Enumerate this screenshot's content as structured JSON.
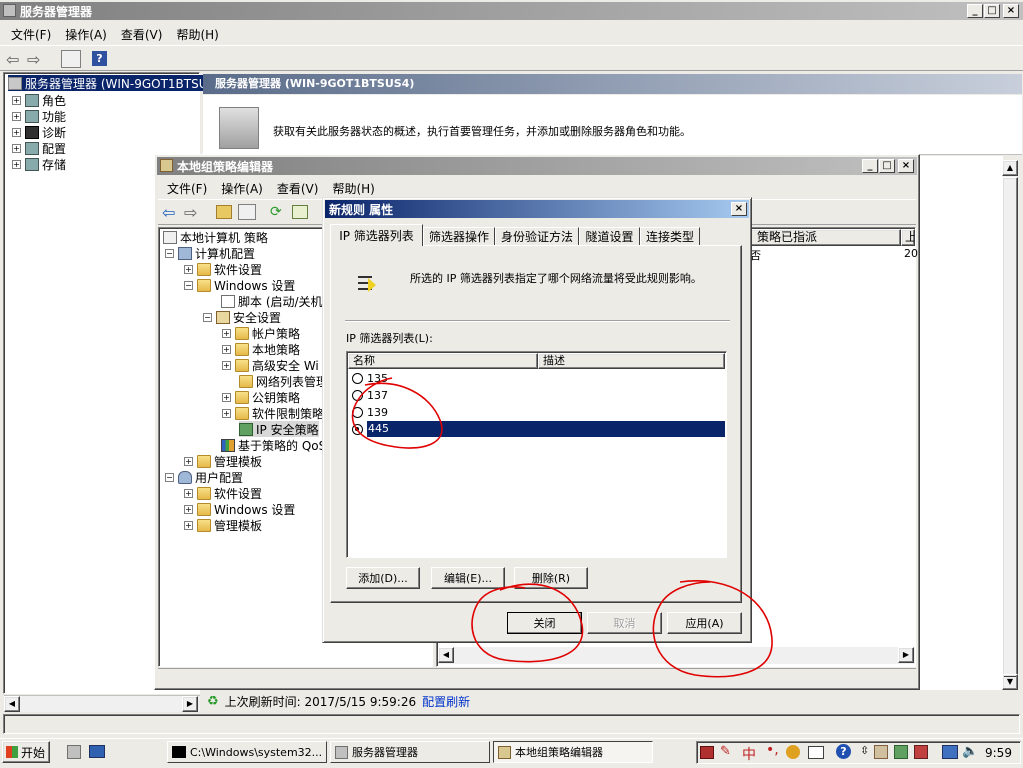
{
  "server_manager": {
    "title": "服务器管理器",
    "menus": [
      "文件(F)",
      "操作(A)",
      "查看(V)",
      "帮助(H)"
    ],
    "tree_root": "服务器管理器 (WIN-9GOT1BTSUS",
    "tree_items": [
      "角色",
      "功能",
      "诊断",
      "配置",
      "存储"
    ],
    "header_title": "服务器管理器 (WIN-9GOT1BTSUS4)",
    "header_desc": "获取有关此服务器状态的概述，执行首要管理任务，并添加或删除服务器角色和功能。",
    "status_prefix": "上次刷新时间: 2017/5/15 9:59:26",
    "status_link": "配置刷新"
  },
  "gpedit": {
    "title": "本地组策略编辑器",
    "menus": [
      "文件(F)",
      "操作(A)",
      "查看(V)",
      "帮助(H)"
    ],
    "tree": {
      "root": "本地计算机 策略",
      "computer_config": "计算机配置",
      "software_settings": "软件设置",
      "windows_settings": "Windows 设置",
      "scripts": "脚本 (启动/关机",
      "security_settings": "安全设置",
      "account_policy": "帐户策略",
      "local_policy": "本地策略",
      "advanced_security": "高级安全 Wi",
      "network_list": "网络列表管理",
      "public_key": "公钥策略",
      "software_restriction": "软件限制策略",
      "ip_security": "IP 安全策略",
      "qos": "基于策略的 QoS",
      "admin_templates": "管理模板",
      "user_config": "用户配置",
      "user_software": "软件设置",
      "user_windows": "Windows 设置",
      "user_admin": "管理模板"
    },
    "right_header_col": "策略已指派",
    "right_header_col2": "上",
    "right_cell": "否",
    "right_cell2": "20"
  },
  "dialog": {
    "title": "新规则 属性",
    "tabs": [
      "IP 筛选器列表",
      "筛选器操作",
      "身份验证方法",
      "隧道设置",
      "连接类型"
    ],
    "description": "所选的 IP 筛选器列表指定了哪个网络流量将受此规则影响。",
    "list_label": "IP 筛选器列表(L):",
    "columns": [
      "名称",
      "描述"
    ],
    "rows": [
      {
        "name": "135",
        "selected": false
      },
      {
        "name": "137",
        "selected": false
      },
      {
        "name": "139",
        "selected": false
      },
      {
        "name": "445",
        "selected": true
      }
    ],
    "add_btn": "添加(D)...",
    "edit_btn": "编辑(E)...",
    "delete_btn": "删除(R)",
    "close_btn": "关闭",
    "cancel_btn": "取消",
    "apply_btn": "应用(A)"
  },
  "taskbar": {
    "start": "开始",
    "tasks": [
      "C:\\Windows\\system32...",
      "服务器管理器",
      "本地组策略编辑器"
    ],
    "ime": "中",
    "clock": "9:59"
  },
  "colors": {
    "selection": "#0a246a",
    "annotation": "#e00000",
    "window_face": "#ecebe6"
  }
}
